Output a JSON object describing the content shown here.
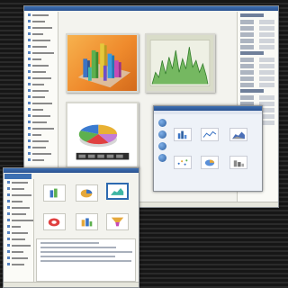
{
  "main_window": {
    "title": "",
    "sidebar_rows": 24,
    "property_rows": 18
  },
  "wizard_window": {
    "title": "",
    "tiles": 6
  },
  "bottom_window": {
    "title": "",
    "tiles": 6,
    "selected_tile": 2
  },
  "colors": {
    "title_bar": "#2a5290",
    "orange_panel": "#ef8a2c",
    "area_green": "#5fae4a",
    "background_stripes": "#1e1e1e"
  }
}
